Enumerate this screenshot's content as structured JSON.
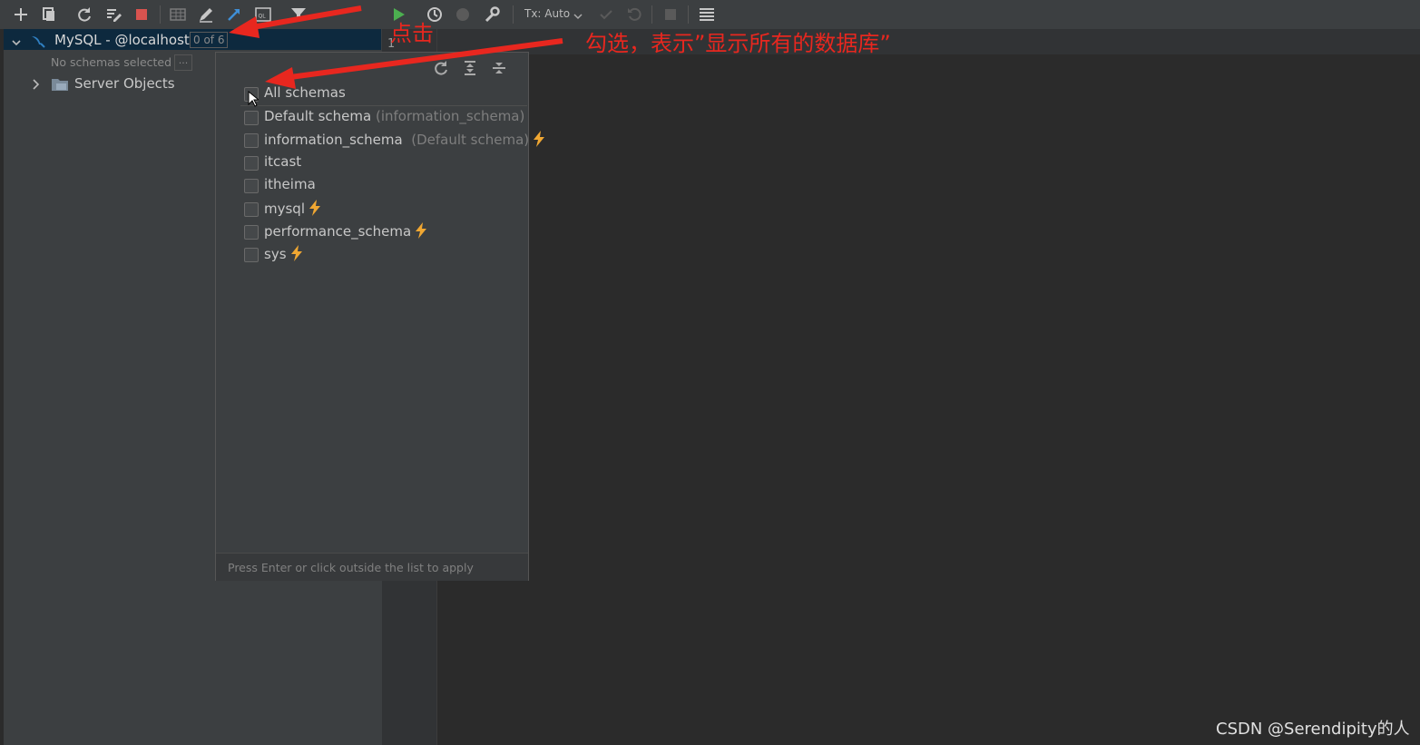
{
  "toolbar": {
    "icons": [
      "add-icon",
      "copy-icon",
      "refresh-icon",
      "edit-properties-icon",
      "stop-icon",
      "table-icon",
      "pencil-icon",
      "jump-icon",
      "console-icon",
      "filter-icon",
      "run-icon",
      "history-icon",
      "record-icon",
      "wrench-icon",
      "commit-icon",
      "rollback-icon",
      "stop-square-icon",
      "list-icon"
    ],
    "tx_label": "Tx: Auto"
  },
  "tree": {
    "connection_label": "MySQL - @localhost",
    "schema_count": "0 of 6",
    "no_schemas": "No schemas selected",
    "more_button": "...",
    "server_objects": "Server Objects"
  },
  "gutter": {
    "line_number": "1"
  },
  "popup": {
    "items": [
      {
        "label": "All schemas",
        "sub": "",
        "bolt": false
      },
      {
        "label": "Default schema",
        "sub": "(information_schema)",
        "bolt": false
      },
      {
        "label": "information_schema",
        "sub": "(Default schema)",
        "bolt": true
      },
      {
        "label": "itcast",
        "sub": "",
        "bolt": false
      },
      {
        "label": "itheima",
        "sub": "",
        "bolt": false
      },
      {
        "label": "mysql",
        "sub": "",
        "bolt": true
      },
      {
        "label": "performance_schema",
        "sub": "",
        "bolt": true
      },
      {
        "label": "sys",
        "sub": "",
        "bolt": true
      }
    ],
    "footer": "Press Enter or click outside the list to apply"
  },
  "annotations": {
    "click": "点击",
    "check": "勾选，表示”显示所有的数据库”"
  },
  "watermark": "CSDN @Serendipity的人",
  "colors": {
    "annotation": "#e8271f",
    "bolt": "#f0a732",
    "selection": "#0d293e",
    "run": "#4caf50"
  }
}
